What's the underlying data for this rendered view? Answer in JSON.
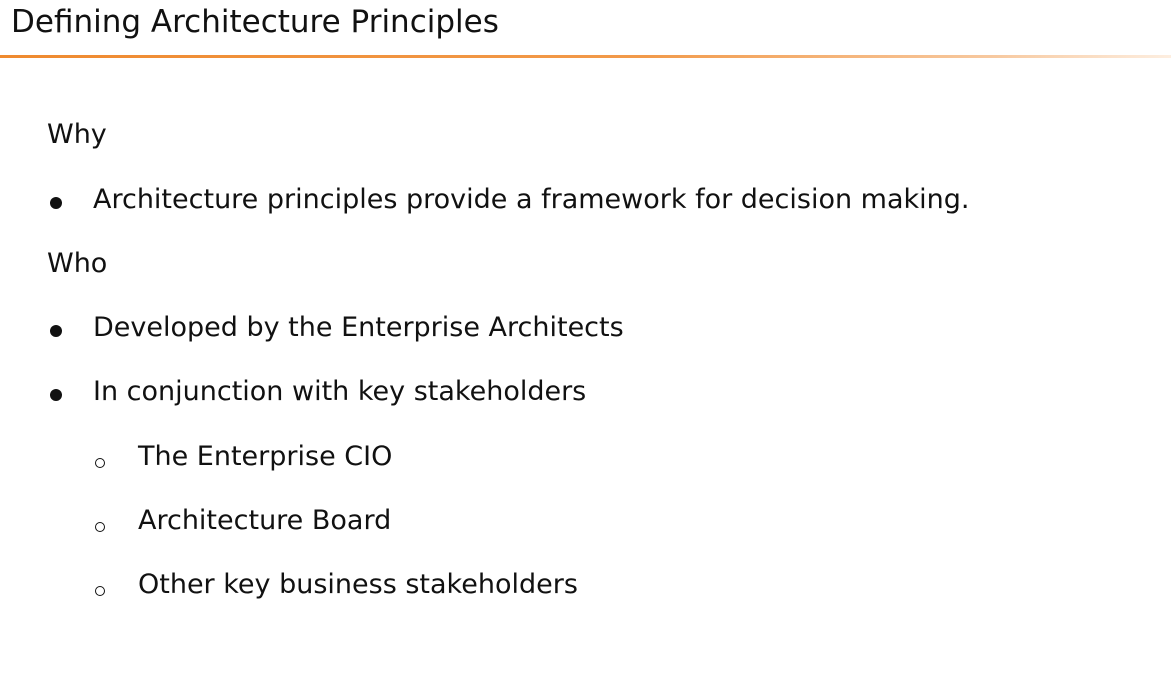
{
  "slide": {
    "title": "Defining Architecture Principles"
  },
  "sections": {
    "why": {
      "heading": "Why",
      "bullets": [
        "Architecture principles provide a framework for decision making."
      ]
    },
    "who": {
      "heading": "Who",
      "bullets": [
        "Developed by the Enterprise Architects",
        "In conjunction with key stakeholders"
      ],
      "sub_bullets": [
        "The Enterprise CIO",
        "Architecture Board",
        "Other key business stakeholders"
      ]
    }
  },
  "colors": {
    "accent_rule": "#ef8a2f",
    "text": "#111111"
  }
}
